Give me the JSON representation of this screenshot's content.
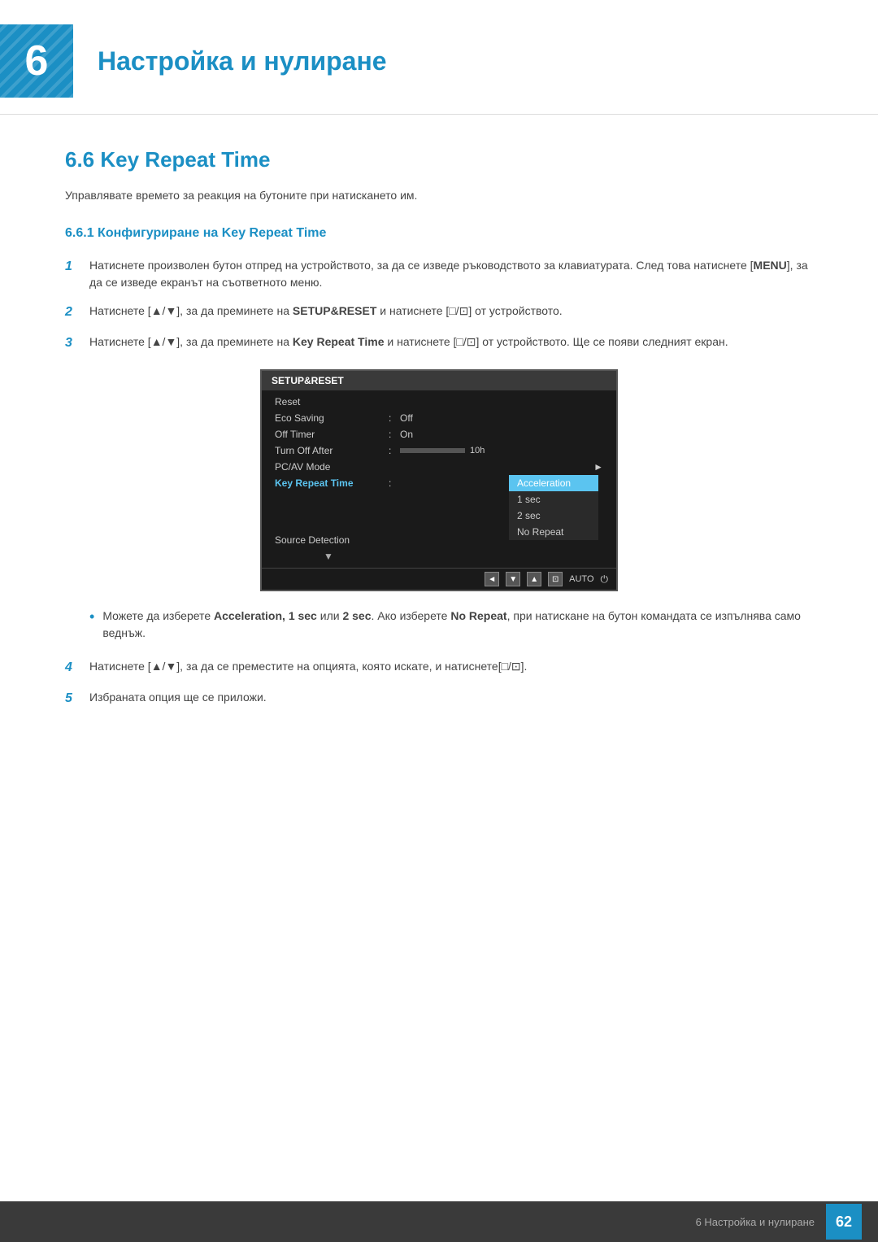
{
  "chapter": {
    "number": "6",
    "title": "Настройка и нулиране"
  },
  "section": {
    "number": "6.6",
    "title": "Key Repeat Time",
    "intro": "Управлявате времето за реакция на бутоните при натискането им."
  },
  "subsection": {
    "number": "6.6.1",
    "title": "Конфигуриране на Key Repeat Time"
  },
  "steps": [
    {
      "num": "1",
      "text": "Натиснете произволен бутон отпред на устройството, за да се изведе ръководството за клавиатурата. След това натиснете [MENU], за да се изведе екранът на съответното меню."
    },
    {
      "num": "2",
      "text": "Натиснете [▲/▼], за да преминете на SETUP&RESET и натиснете [□/⊡] от устройството."
    },
    {
      "num": "3",
      "text": "Натиснете [▲/▼], за да преминете на Key Repeat Time и натиснете [□/⊡] от устройството. Ще се появи следният екран."
    }
  ],
  "screen": {
    "title": "SETUP&RESET",
    "rows": [
      {
        "label": "Reset",
        "colon": "",
        "value": "",
        "type": "plain"
      },
      {
        "label": "Eco Saving",
        "colon": ":",
        "value": "Off",
        "type": "plain"
      },
      {
        "label": "Off Timer",
        "colon": ":",
        "value": "On",
        "type": "plain"
      },
      {
        "label": "Turn Off After",
        "colon": ":",
        "value": "progress_10h",
        "type": "progress"
      },
      {
        "label": "PC/AV Mode",
        "colon": "",
        "value": "▶",
        "type": "arrow"
      },
      {
        "label": "Key Repeat Time",
        "colon": ":",
        "value": "dropdown",
        "type": "highlighted"
      },
      {
        "label": "Source Detection",
        "colon": "",
        "value": "",
        "type": "plain"
      },
      {
        "label": "▼",
        "colon": "",
        "value": "",
        "type": "plain"
      }
    ],
    "dropdown": {
      "items": [
        {
          "label": "Acceleration",
          "active": true
        },
        {
          "label": "1 sec",
          "active": false
        },
        {
          "label": "2 sec",
          "active": false
        },
        {
          "label": "No Repeat",
          "active": false
        }
      ]
    },
    "toolbar": {
      "buttons": [
        "◄",
        "▼",
        "▲",
        "⊡"
      ],
      "auto": "AUTO",
      "power": "⏻"
    }
  },
  "bullet": {
    "text_before": "Можете да изберете ",
    "options_bold": "Acceleration, 1 sec или 2 sec",
    "text_mid": ". Ако изберете ",
    "no_repeat_bold": "No Repeat",
    "text_after": ", при натискане на бутон командата се изпълнява само веднъж."
  },
  "steps_continued": [
    {
      "num": "4",
      "text": "Натиснете [▲/▼], за да се преместите на опцията, която искате, и натиснете[□/⊡]."
    },
    {
      "num": "5",
      "text": "Избраната опция ще се приложи."
    }
  ],
  "footer": {
    "text": "6 Настройка и нулиране",
    "page_num": "62"
  }
}
